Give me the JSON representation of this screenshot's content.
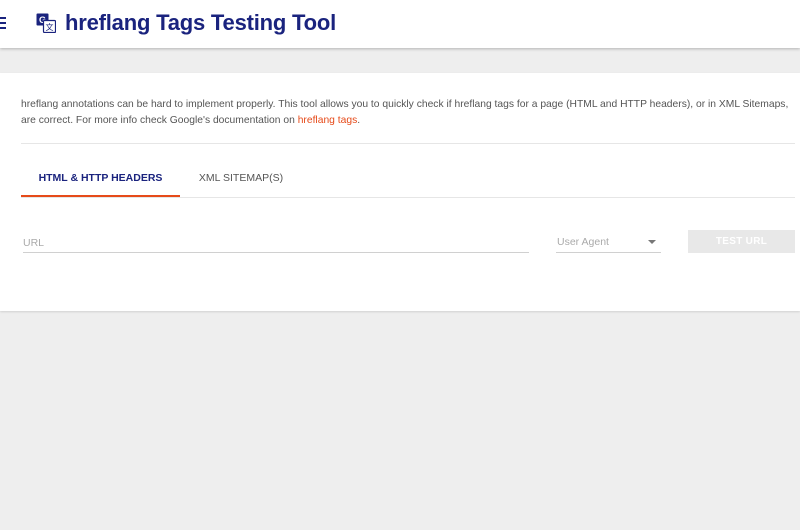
{
  "header": {
    "title": "hreflang Tags Testing Tool",
    "logo_icon": "translate-icon",
    "menu_icon": "hamburger-menu-icon",
    "accent_color": "#1a237e"
  },
  "intro": {
    "text_before_link": "hreflang annotations can be hard to implement properly. This tool allows you to quickly check if hreflang tags for a page (HTML and HTTP headers), or in XML Sitemaps, are correct. For more info check Google's documentation on ",
    "link_text": "hreflang tags",
    "text_after_link": ".",
    "link_color": "#e64a19"
  },
  "tabs": [
    {
      "label": "HTML & HTTP HEADERS",
      "active": true
    },
    {
      "label": "XML SITEMAP(S)",
      "active": false
    }
  ],
  "form": {
    "url_placeholder": "URL",
    "user_agent_label": "User Agent",
    "submit_label": "TEST URL"
  }
}
